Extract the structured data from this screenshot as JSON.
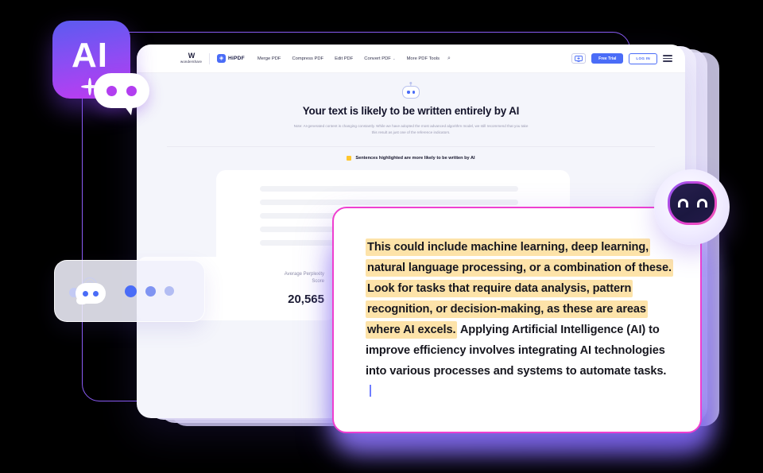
{
  "nav": {
    "brand_mark": "W",
    "brand_name": "wondershare",
    "product_icon": "◈",
    "product_name": "HiPDF",
    "links": [
      {
        "label": "Merge PDF",
        "has_caret": false
      },
      {
        "label": "Compress PDF",
        "has_caret": false
      },
      {
        "label": "Edit PDF",
        "has_caret": false
      },
      {
        "label": "Convert PDF",
        "has_caret": true
      },
      {
        "label": "More PDF Tools",
        "has_caret": false
      }
    ],
    "caret_glyph": "⌄",
    "search_icon": "search-icon",
    "search_glyph": "⌕",
    "download_icon": "desktop-download-icon",
    "free_trial_label": "Free Trial",
    "login_label": "LOG IN",
    "menu_icon": "hamburger-menu-icon"
  },
  "result": {
    "bot_icon": "ai-robot-icon",
    "headline": "Your text is likely to be written entirely by AI",
    "note": "Note: AI-generated content is changing constantly. While we have adopted the most advanced algorithm model, we still recommend that you take this result as just one of the reference indicators.",
    "legend_label": "Sentences highlighted are more likely to be written by AI",
    "legend_color": "#ffc62e"
  },
  "score": {
    "label_line1": "Average Perplexity",
    "label_line2": "Score",
    "value": "20,565"
  },
  "popup": {
    "border_color": "#ef3fd0",
    "highlight_color": "#fde3a9",
    "highlighted_text": "This could include machine learning, deep learning, natural language processing, or a combination of these. Look for tasks that require data analysis, pattern recognition, or decision-making, as these are areas where AI excels.",
    "plain_text": " Applying Artificial Intelligence (AI) to improve efficiency involves integrating AI technologies into various processes and systems to automate tasks. ",
    "caret": "text-cursor"
  },
  "ai_badge": {
    "label": "AI",
    "sparkle_icon": "sparkle-icon",
    "bubble_icon": "chat-bubble-icon",
    "gradient_start": "#5b5bf0",
    "gradient_end": "#c03bf0"
  },
  "typing_card": {
    "robot_icon": "robot-waving-icon",
    "dots": [
      "dot-1",
      "dot-2",
      "dot-3"
    ],
    "dot_color": "#4a6cf7"
  },
  "avatar": {
    "icon": "robot-face-avatar",
    "ring_gradient_start": "#8b5cf6",
    "ring_gradient_end": "#f05bb6"
  }
}
